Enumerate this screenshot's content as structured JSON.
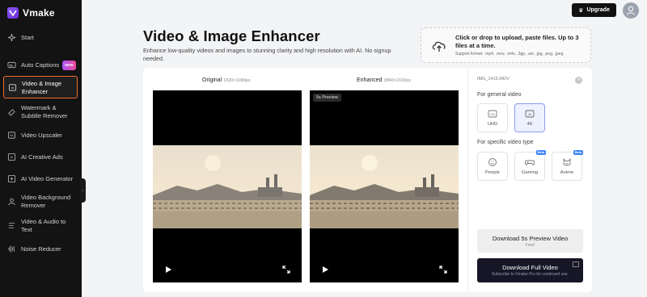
{
  "brand": {
    "name": "Vmake"
  },
  "sidebar": {
    "items": [
      {
        "label": "Start",
        "icon": "sparkle-icon"
      },
      {
        "label": "Auto Captions",
        "icon": "captions-icon",
        "badge": "NEW"
      },
      {
        "label": "Video & Image Enhancer",
        "icon": "enhancer-icon",
        "active": true
      },
      {
        "label": "Watermark & Subtitle Remover",
        "icon": "eraser-icon"
      },
      {
        "label": "Video Upscaler",
        "icon": "upscale-icon"
      },
      {
        "label": "AI Creative Ads",
        "icon": "ai-ads-icon"
      },
      {
        "label": "AI Video Generator",
        "icon": "video-generator-icon"
      },
      {
        "label": "Video Background Remover",
        "icon": "background-remover-icon"
      },
      {
        "label": "Video & Audio to Text",
        "icon": "transcribe-icon"
      },
      {
        "label": "Noise Reducer",
        "icon": "noise-icon"
      }
    ]
  },
  "header": {
    "upgrade_label": "Upgrade"
  },
  "page": {
    "title": "Video & Image Enhancer",
    "subtitle": "Enhance low-quality videos and images to stunning clarity and high resolution with AI. No signup needed."
  },
  "upload": {
    "main": "Click or drop to upload, paste files. Up to 3 files at a time.",
    "formats": "Support format: .mp4, .mov, .m4v, .3gp, .avi, .jpg, .png, .jpeg"
  },
  "compare": {
    "original_label": "Original",
    "original_res": "1920×1080px",
    "enhanced_label": "Enhanced",
    "enhanced_res": "3840×2160px",
    "preview_tag": "5s Preview"
  },
  "panel": {
    "file_name": "IMG_1415.MOV",
    "general_label": "For general video",
    "general_options": [
      {
        "label": "UHD",
        "selected": false
      },
      {
        "label": "4K",
        "selected": true
      }
    ],
    "specific_label": "For specific video type",
    "specific_options": [
      {
        "label": "People",
        "beta": false
      },
      {
        "label": "Gaming",
        "beta": true
      },
      {
        "label": "Anime",
        "beta": true
      }
    ],
    "beta_label": "Beta",
    "preview_button": {
      "title": "Download 5s Preview Video",
      "sub": "Free!"
    },
    "full_button": {
      "title": "Download Full Video",
      "sub": "Subscribe to Vmake Pro for continued use."
    }
  },
  "colors": {
    "accent": "#ef6b2b",
    "brand": "#7c3aed",
    "selected": "#8b9cf0"
  }
}
